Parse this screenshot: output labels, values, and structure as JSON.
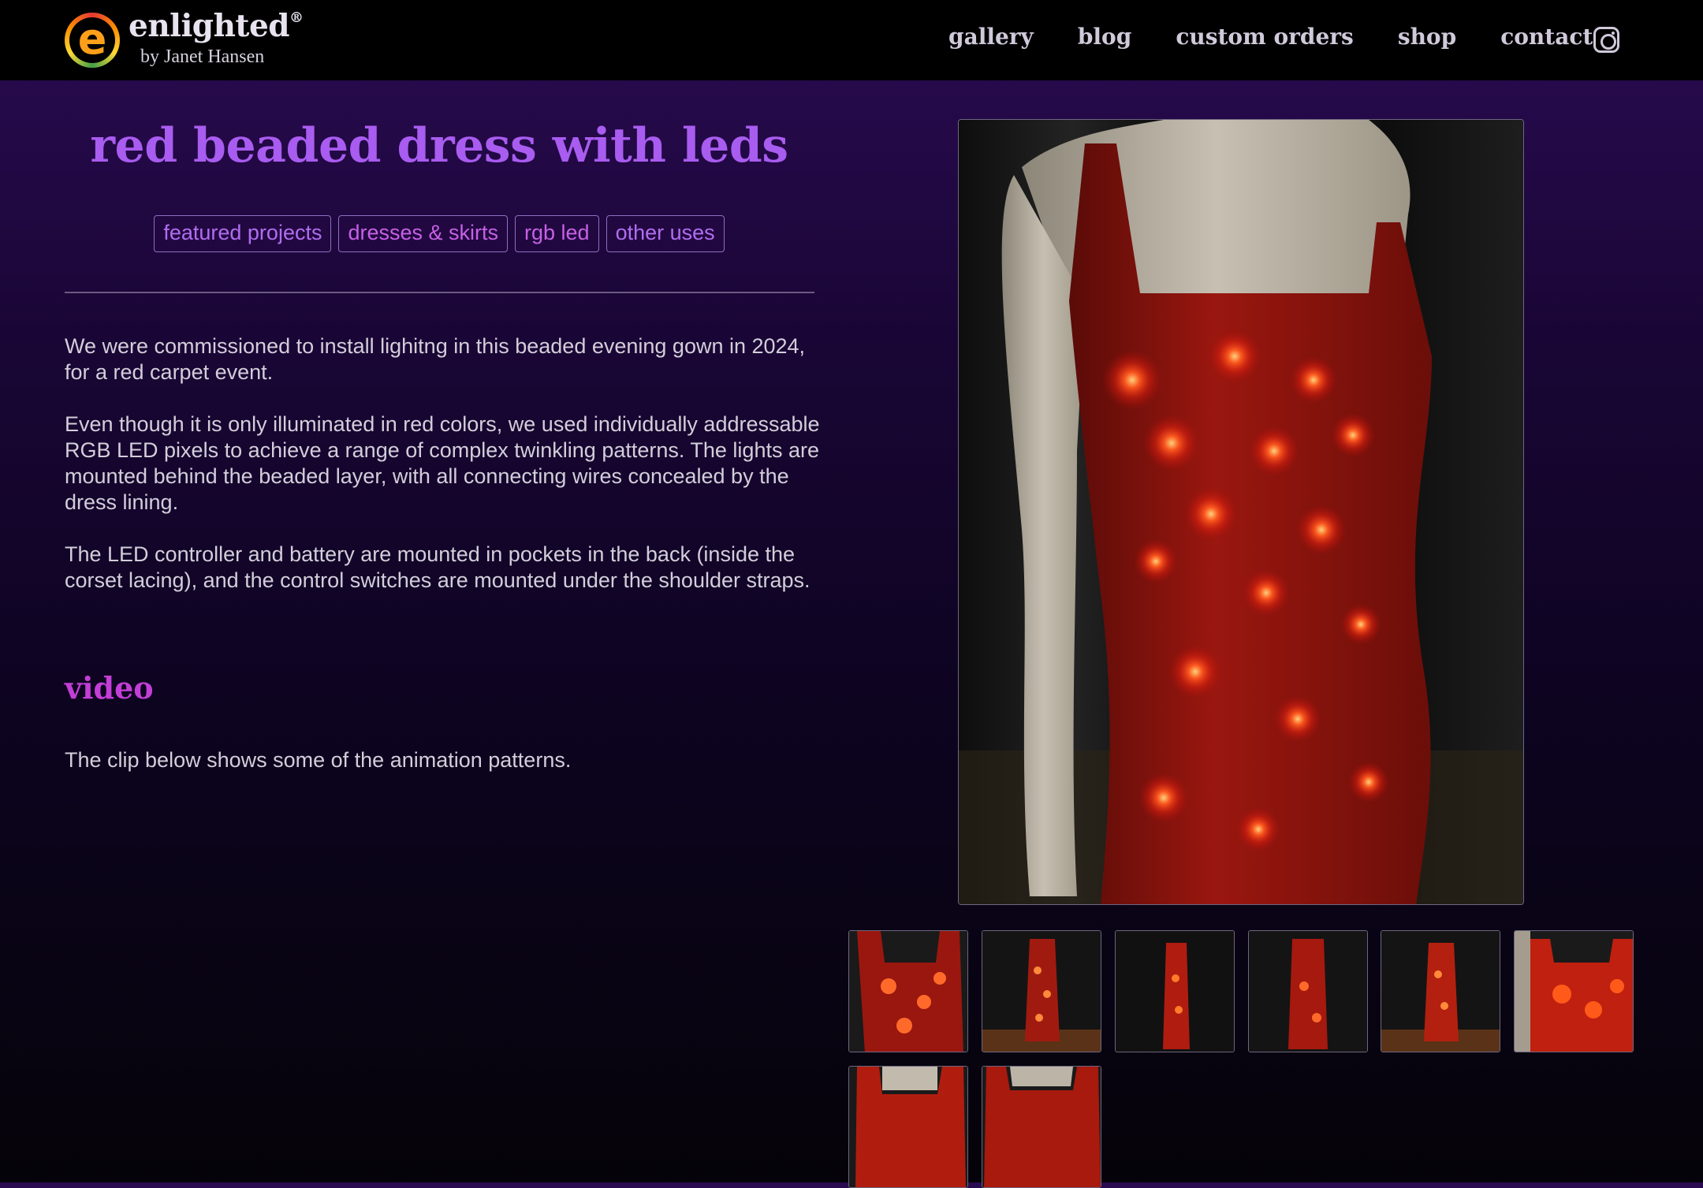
{
  "header": {
    "brand_name": "enlighted",
    "brand_mark": "®",
    "byline": "by Janet Hansen",
    "logo_letter": "e",
    "nav": [
      "gallery",
      "blog",
      "custom orders",
      "shop",
      "contact"
    ],
    "social_icon": "instagram-icon"
  },
  "page": {
    "title": "red beaded dress with leds",
    "tags": [
      "featured projects",
      "dresses & skirts",
      "rgb led",
      "other uses"
    ],
    "paragraphs": [
      "We were commissioned to install lighitng in this beaded evening gown in 2024, for a red carpet event.",
      "Even though it is only illuminated in red colors, we used individually addressable RGB LED pixels to achieve a range of complex twinkling patterns. The lights are mounted behind the beaded layer, with all connecting wires concealed by the dress lining.",
      "The LED controller and battery are mounted in pockets in the back (inside the corset lacing), and the control switches are mounted under the shoulder straps."
    ],
    "video_heading": "video",
    "video_caption": "The clip below shows some of the animation patterns."
  },
  "gallery": {
    "main_image": "red-beaded-dress-photo",
    "thumbnails": [
      "dress-thumb-1",
      "dress-thumb-2",
      "dress-thumb-3",
      "dress-thumb-4",
      "dress-thumb-5",
      "dress-thumb-6",
      "dress-thumb-7",
      "dress-thumb-8"
    ]
  },
  "colors": {
    "title": "#a95cf0",
    "section_heading": "#c23ed6",
    "tag_text": "#c661e6",
    "background_top": "#2a0b52",
    "header_bg": "#000000"
  }
}
